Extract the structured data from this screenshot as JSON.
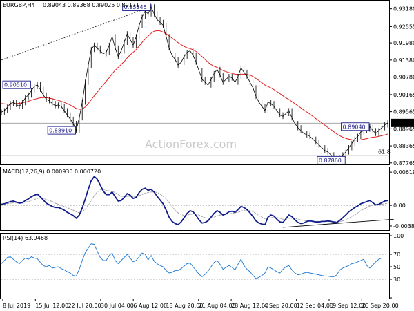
{
  "header": {
    "symbol": "EURGBP,H4",
    "ohlc": "0.89043 0.89368 0.89025 0.89171",
    "macd_label": "MACD(12,26,9) 0.000930 0.000720",
    "rsi_label": "RSI(14) 63.9468"
  },
  "watermark": "ActionForex.com",
  "colors": {
    "price": "#000000",
    "ema": "#e02020",
    "macd": "#101c8c",
    "signal": "#a0a0a0",
    "rsi": "#2a7fd4",
    "box_border": "#1a1a8c",
    "current_price_bg": "#000000"
  },
  "chart_data": [
    {
      "panel": "price",
      "type": "line",
      "title": "EURGBP,H4",
      "x_labels": [
        "8 Jul 2019",
        "15 Jul 12:00",
        "22 Jul 20:00",
        "30 Jul 04:00",
        "6 Aug 12:00",
        "13 Aug 20:00",
        "21 Aug 04:00",
        "28 Aug 12:00",
        "4 Sep 20:00",
        "12 Sep 04:00",
        "19 Sep 12:00",
        "26 Sep 20:00"
      ],
      "y_ticks": [
        "0.93180",
        "0.92555",
        "0.91980",
        "0.91380",
        "0.90780",
        "0.90165",
        "0.89565",
        "0.88965",
        "0.88365",
        "0.87765"
      ],
      "ylim": [
        0.8776,
        0.9339
      ],
      "current_price": "0.89171",
      "fib_label": "61.8",
      "fib_level": 0.8802,
      "hline": 0.8916,
      "annotations": [
        {
          "text": "0.93245",
          "x": 50,
          "y": 0.93245,
          "pos": "left"
        },
        {
          "text": "0.90510",
          "x": 10,
          "y": 0.9051,
          "pos": "left"
        },
        {
          "text": "0.88910",
          "x": 25,
          "y": 0.8891,
          "pos": "left"
        },
        {
          "text": "0.89040",
          "x": 123,
          "y": 0.8904,
          "pos": "left"
        },
        {
          "text": "0.87860",
          "x": 115,
          "y": 0.8786,
          "pos": "left"
        }
      ],
      "trendline": [
        [
          0,
          0.9138
        ],
        [
          50,
          0.93245
        ]
      ],
      "series": [
        {
          "kind": "price",
          "values": [
            0.8955,
            0.896,
            0.8972,
            0.8985,
            0.899,
            0.8982,
            0.8975,
            0.8988,
            0.9005,
            0.9015,
            0.903,
            0.9045,
            0.9051,
            0.9035,
            0.9015,
            0.9,
            0.8995,
            0.8985,
            0.8978,
            0.898,
            0.8975,
            0.896,
            0.8945,
            0.893,
            0.8915,
            0.8891,
            0.8935,
            0.899,
            0.906,
            0.912,
            0.9175,
            0.919,
            0.918,
            0.917,
            0.916,
            0.9165,
            0.919,
            0.922,
            0.918,
            0.915,
            0.917,
            0.92,
            0.923,
            0.921,
            0.919,
            0.922,
            0.926,
            0.929,
            0.931,
            0.93,
            0.93245,
            0.93,
            0.928,
            0.927,
            0.926,
            0.922,
            0.918,
            0.9155,
            0.914,
            0.912,
            0.913,
            0.915,
            0.9165,
            0.917,
            0.9155,
            0.913,
            0.91,
            0.907,
            0.906,
            0.905,
            0.907,
            0.909,
            0.9105,
            0.9085,
            0.906,
            0.907,
            0.908,
            0.9075,
            0.906,
            0.908,
            0.911,
            0.9095,
            0.908,
            0.906,
            0.904,
            0.901,
            0.899,
            0.8975,
            0.896,
            0.899,
            0.8985,
            0.8975,
            0.896,
            0.8945,
            0.894,
            0.895,
            0.896,
            0.8935,
            0.8915,
            0.89,
            0.889,
            0.888,
            0.8875,
            0.887,
            0.886,
            0.885,
            0.884,
            0.883,
            0.882,
            0.8815,
            0.8805,
            0.8795,
            0.8786,
            0.8795,
            0.8805,
            0.8815,
            0.883,
            0.8845,
            0.886,
            0.887,
            0.8885,
            0.889,
            0.8895,
            0.8904,
            0.889,
            0.888,
            0.889,
            0.89,
            0.891,
            0.8917
          ]
        },
        {
          "kind": "ema",
          "values": [
            0.8985,
            0.8984,
            0.8983,
            0.8983,
            0.8984,
            0.8985,
            0.8986,
            0.8988,
            0.899,
            0.8993,
            0.8997,
            0.9,
            0.9003,
            0.9005,
            0.9006,
            0.9006,
            0.9004,
            0.9002,
            0.8999,
            0.8996,
            0.8993,
            0.8989,
            0.8985,
            0.898,
            0.8974,
            0.8968,
            0.8965,
            0.8966,
            0.8973,
            0.8985,
            0.8998,
            0.9012,
            0.9025,
            0.9038,
            0.905,
            0.9063,
            0.9076,
            0.909,
            0.9102,
            0.9112,
            0.9122,
            0.9133,
            0.9145,
            0.9156,
            0.9165,
            0.9175,
            0.9187,
            0.92,
            0.9212,
            0.9222,
            0.9232,
            0.9239,
            0.9241,
            0.924,
            0.9236,
            0.923,
            0.9223,
            0.9215,
            0.9207,
            0.9199,
            0.9192,
            0.9186,
            0.9181,
            0.9178,
            0.9174,
            0.9168,
            0.916,
            0.915,
            0.914,
            0.913,
            0.9122,
            0.9116,
            0.9112,
            0.9107,
            0.9101,
            0.9097,
            0.9094,
            0.9091,
            0.9088,
            0.9087,
            0.9088,
            0.9088,
            0.9087,
            0.9085,
            0.908,
            0.9073,
            0.9066,
            0.9058,
            0.905,
            0.9045,
            0.904,
            0.9034,
            0.9027,
            0.902,
            0.9012,
            0.9005,
            0.8999,
            0.8992,
            0.8985,
            0.8977,
            0.897,
            0.8962,
            0.8955,
            0.8948,
            0.894,
            0.8932,
            0.8925,
            0.8917,
            0.8909,
            0.8901,
            0.8894,
            0.8886,
            0.8878,
            0.8872,
            0.8867,
            0.8863,
            0.886,
            0.8858,
            0.8857,
            0.8857,
            0.8858,
            0.886,
            0.8862,
            0.8865,
            0.8867,
            0.8868,
            0.887,
            0.8872,
            0.8875,
            0.8878
          ]
        }
      ]
    },
    {
      "panel": "macd",
      "type": "line",
      "title": "MACD(12,26,9) 0.000930 0.000720",
      "y_ticks": [
        "0.006195",
        "0.00",
        "-0.003851"
      ],
      "ylim": [
        -0.0045,
        0.0066
      ],
      "trendline": [
        [
          94,
          -0.0041
        ],
        [
          131,
          -0.0026
        ]
      ],
      "series": [
        {
          "kind": "macd",
          "values": [
            0.0002,
            0.0003,
            0.0005,
            0.0007,
            0.0008,
            0.0006,
            0.0004,
            0.0005,
            0.0009,
            0.0012,
            0.0016,
            0.0019,
            0.0021,
            0.0016,
            0.001,
            0.0004,
            0.0001,
            -0.0002,
            -0.0004,
            -0.0004,
            -0.0006,
            -0.0009,
            -0.0013,
            -0.0016,
            -0.0019,
            -0.0024,
            -0.0018,
            -0.0005,
            0.0012,
            0.003,
            0.0046,
            0.0054,
            0.0049,
            0.0038,
            0.0027,
            0.002,
            0.002,
            0.0025,
            0.0016,
            0.0008,
            0.0009,
            0.0015,
            0.0022,
            0.0019,
            0.0013,
            0.0015,
            0.0024,
            0.003,
            0.0032,
            0.0028,
            0.003,
            0.0025,
            0.0017,
            0.001,
            0.0003,
            -0.0009,
            -0.0022,
            -0.003,
            -0.0034,
            -0.0036,
            -0.0031,
            -0.0023,
            -0.0015,
            -0.001,
            -0.0012,
            -0.0019,
            -0.0027,
            -0.0033,
            -0.0032,
            -0.0029,
            -0.0022,
            -0.0015,
            -0.001,
            -0.0013,
            -0.0018,
            -0.0016,
            -0.0012,
            -0.0011,
            -0.0013,
            -0.0008,
            -0.0002,
            -0.0004,
            -0.0008,
            -0.0014,
            -0.0021,
            -0.0029,
            -0.0033,
            -0.0035,
            -0.0036,
            -0.0022,
            -0.0018,
            -0.002,
            -0.0026,
            -0.0031,
            -0.0032,
            -0.0025,
            -0.0018,
            -0.0021,
            -0.0027,
            -0.0032,
            -0.0034,
            -0.0033,
            -0.003,
            -0.0029,
            -0.003,
            -0.0031,
            -0.0031,
            -0.003,
            -0.003,
            -0.0029,
            -0.003,
            -0.0031,
            -0.0032,
            -0.0028,
            -0.0023,
            -0.0018,
            -0.0012,
            -0.0008,
            -0.0004,
            -0.0001,
            0.0003,
            0.0005,
            0.0007,
            0.0009,
            0.0005,
            0.0001,
            0.0002,
            0.0005,
            0.0008,
            0.0009
          ]
        },
        {
          "kind": "signal",
          "values": [
            0.0001,
            0.0002,
            0.0003,
            0.0004,
            0.0005,
            0.0005,
            0.0005,
            0.0005,
            0.0006,
            0.0007,
            0.0009,
            0.0011,
            0.0013,
            0.0014,
            0.0013,
            0.0011,
            0.0009,
            0.0007,
            0.0004,
            0.0002,
            0.0,
            -0.0002,
            -0.0004,
            -0.0007,
            -0.0009,
            -0.0012,
            -0.0014,
            -0.0012,
            -0.0007,
            0.0,
            0.0009,
            0.0018,
            0.0025,
            0.0029,
            0.003,
            0.0028,
            0.0027,
            0.0026,
            0.0024,
            0.002,
            0.0017,
            0.0016,
            0.0017,
            0.0017,
            0.0016,
            0.0016,
            0.0018,
            0.002,
            0.0023,
            0.0024,
            0.0025,
            0.0025,
            0.0024,
            0.0021,
            0.0017,
            0.0012,
            0.0005,
            -0.0002,
            -0.0009,
            -0.0014,
            -0.0017,
            -0.0019,
            -0.0018,
            -0.0017,
            -0.0016,
            -0.0016,
            -0.0018,
            -0.0021,
            -0.0023,
            -0.0024,
            -0.0024,
            -0.0022,
            -0.002,
            -0.0018,
            -0.0018,
            -0.0017,
            -0.0016,
            -0.0015,
            -0.0014,
            -0.0013,
            -0.0011,
            -0.0009,
            -0.0009,
            -0.001,
            -0.0012,
            -0.0015,
            -0.0019,
            -0.0022,
            -0.0025,
            -0.0024,
            -0.0023,
            -0.0022,
            -0.0023,
            -0.0024,
            -0.0026,
            -0.0026,
            -0.0024,
            -0.0024,
            -0.0024,
            -0.0026,
            -0.0027,
            -0.0028,
            -0.0029,
            -0.0029,
            -0.0029,
            -0.003,
            -0.003,
            -0.003,
            -0.003,
            -0.003,
            -0.003,
            -0.003,
            -0.0031,
            -0.003,
            -0.0029,
            -0.0027,
            -0.0024,
            -0.0021,
            -0.0018,
            -0.0014,
            -0.001,
            -0.0007,
            -0.0004,
            -0.0001,
            0.0,
            0.0,
            0.0001,
            0.0002,
            0.0003,
            0.0004
          ]
        }
      ]
    },
    {
      "panel": "rsi",
      "type": "line",
      "title": "RSI(14) 63.9468",
      "y_ticks": [
        "100",
        "70",
        "50",
        "30",
        "0"
      ],
      "ylim": [
        0,
        100
      ],
      "levels": [
        30,
        70
      ],
      "series": [
        {
          "kind": "rsi",
          "values": [
            55,
            60,
            65,
            66,
            62,
            58,
            55,
            60,
            64,
            62,
            66,
            64,
            63,
            57,
            52,
            50,
            52,
            48,
            49,
            50,
            47,
            45,
            42,
            40,
            36,
            35,
            46,
            60,
            73,
            80,
            87,
            86,
            75,
            65,
            60,
            60,
            68,
            72,
            60,
            55,
            60,
            65,
            70,
            64,
            58,
            60,
            66,
            72,
            70,
            61,
            68,
            59,
            55,
            52,
            50,
            44,
            40,
            41,
            44,
            44,
            47,
            51,
            55,
            56,
            50,
            44,
            38,
            34,
            38,
            43,
            50,
            57,
            60,
            54,
            46,
            49,
            52,
            49,
            45,
            54,
            62,
            52,
            46,
            42,
            36,
            31,
            33,
            36,
            40,
            50,
            48,
            45,
            42,
            40,
            46,
            50,
            52,
            45,
            40,
            37,
            38,
            40,
            41,
            40,
            39,
            38,
            37,
            36,
            35,
            35,
            34,
            34,
            37,
            45,
            48,
            50,
            52,
            55,
            56,
            58,
            60,
            62,
            52,
            48,
            53,
            58,
            62,
            64
          ]
        }
      ]
    }
  ]
}
